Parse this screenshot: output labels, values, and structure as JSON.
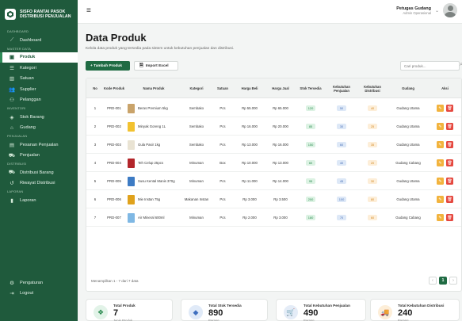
{
  "brand": {
    "line1": "SISFO RANTAI PASOK",
    "line2": "DISTRIBUSI PENJUALAN"
  },
  "sidebar": {
    "sections": [
      {
        "title": "DASHBOARD",
        "items": [
          {
            "label": "Dashboard",
            "icon": "chart-line-icon"
          }
        ]
      },
      {
        "title": "MASTER DATA",
        "items": [
          {
            "label": "Produk",
            "icon": "box-icon",
            "active": true
          },
          {
            "label": "Kategori",
            "icon": "list-icon"
          },
          {
            "label": "Satuan",
            "icon": "scale-icon"
          },
          {
            "label": "Supplier",
            "icon": "users-icon"
          },
          {
            "label": "Pelanggan",
            "icon": "user-group-icon"
          }
        ]
      },
      {
        "title": "INVENTORI",
        "items": [
          {
            "label": "Stok Barang",
            "icon": "cube-icon"
          },
          {
            "label": "Gudang",
            "icon": "warehouse-icon"
          }
        ]
      },
      {
        "title": "PENJUALAN",
        "items": [
          {
            "label": "Pesanan Penjualan",
            "icon": "calendar-icon"
          },
          {
            "label": "Penjualan",
            "icon": "cart-icon"
          }
        ]
      },
      {
        "title": "DISTRIBUSI",
        "items": [
          {
            "label": "Distribusi Barang",
            "icon": "truck-icon"
          },
          {
            "label": "Riwayat Distribusi",
            "icon": "history-icon"
          }
        ]
      },
      {
        "title": "LAPORAN",
        "items": [
          {
            "label": "Laporan",
            "icon": "bar-chart-icon"
          }
        ]
      }
    ],
    "footer": [
      {
        "label": "Pengaturan",
        "icon": "gear-icon"
      },
      {
        "label": "Logout",
        "icon": "logout-icon"
      }
    ]
  },
  "topbar": {
    "user_name": "Petugas Gudang",
    "user_role": "Admin Operasional"
  },
  "main": {
    "title": "Data Produk",
    "subtitle": "Kelola data produk yang tersedia pada sistem untuk kebutuhan penjualan dan distribusi.",
    "add_button": "+ Tambah Produk",
    "import_button": "Import Excel",
    "search_placeholder": "Cari produk..."
  },
  "table": {
    "headers": [
      "No",
      "Kode Produk",
      "Nama Produk",
      "Kategori",
      "Satuan",
      "Harga Beli",
      "Harga Jual",
      "Stok Tersedia",
      "Kebutuhan Penjualan",
      "Kebutuhan Distribusi",
      "Gudang",
      "Aksi"
    ],
    "rows": [
      {
        "no": "1",
        "kode": "PRD-001",
        "nama": "Beras Premium 5kg",
        "kategori": "Sembako",
        "satuan": "Pcs",
        "beli": "Rp 55.000",
        "jual": "Rp 65.000",
        "stok": "120",
        "kpenj": "50",
        "kdist": "40",
        "gudang": "Gudang Utama",
        "thumb": "#c9a36a"
      },
      {
        "no": "2",
        "kode": "PRD-002",
        "nama": "Minyak Goreng 1L",
        "kategori": "Sembako",
        "satuan": "Pcs",
        "beli": "Rp 16.000",
        "jual": "Rp 20.000",
        "stok": "85",
        "kpenj": "30",
        "kdist": "25",
        "gudang": "Gudang Utama",
        "thumb": "#f2c230"
      },
      {
        "no": "3",
        "kode": "PRD-003",
        "nama": "Gula Pasir 1kg",
        "kategori": "Sembako",
        "satuan": "Pcs",
        "beli": "Rp 13.000",
        "jual": "Rp 16.000",
        "stok": "150",
        "kpenj": "60",
        "kdist": "35",
        "gudang": "Gudang Utama",
        "thumb": "#e9e3d3"
      },
      {
        "no": "4",
        "kode": "PRD-004",
        "nama": "Teh Celup 25pcs",
        "kategori": "Minuman",
        "satuan": "Box",
        "beli": "Rp 10.000",
        "jual": "Rp 13.000",
        "stok": "60",
        "kpenj": "40",
        "kdist": "20",
        "gudang": "Gudang Cabang",
        "thumb": "#b3262b"
      },
      {
        "no": "5",
        "kode": "PRD-005",
        "nama": "Susu Kental Manis 370g",
        "kategori": "Minuman",
        "satuan": "Pcs",
        "beli": "Rp 11.000",
        "jual": "Rp 14.000",
        "stok": "95",
        "kpenj": "45",
        "kdist": "30",
        "gudang": "Gudang Utama",
        "thumb": "#3d7bc4"
      },
      {
        "no": "6",
        "kode": "PRD-006",
        "nama": "Mie Instan 75g",
        "kategori": "Makanan Instan",
        "satuan": "Pcs",
        "beli": "Rp 3.000",
        "jual": "Rp 3.500",
        "stok": "200",
        "kpenj": "100",
        "kdist": "80",
        "gudang": "Gudang Utama",
        "thumb": "#e0a21c"
      },
      {
        "no": "7",
        "kode": "PRD-007",
        "nama": "Air Mineral 600ml",
        "kategori": "Minuman",
        "satuan": "Pcs",
        "beli": "Rp 2.000",
        "jual": "Rp 3.000",
        "stok": "180",
        "kpenj": "70",
        "kdist": "60",
        "gudang": "Gudang Cabang",
        "thumb": "#7fb8e4"
      }
    ],
    "showing": "Menampilkan 1 - 7 dari 7 data",
    "page": "1",
    "prev": "‹",
    "next": "›"
  },
  "summary": [
    {
      "title": "Total Produk",
      "value": "7",
      "unit": "Jenis Produk",
      "icon": "box-icon",
      "bg": "#e2f3e8",
      "color": "#2a8a4f"
    },
    {
      "title": "Total Stok Tersedia",
      "value": "890",
      "unit": "Barang",
      "icon": "cube-icon",
      "bg": "#e0eaf8",
      "color": "#3f6fbf"
    },
    {
      "title": "Total Kebutuhan Penjualan",
      "value": "490",
      "unit": "Barang",
      "icon": "cart-icon",
      "bg": "#e4ecf7",
      "color": "#2b5aa3"
    },
    {
      "title": "Total Kebutuhan Distribusi",
      "value": "240",
      "unit": "Barang",
      "icon": "truck-icon",
      "bg": "#fdeed8",
      "color": "#e48a1a"
    }
  ],
  "colors": {
    "sidebar": "#1f5a3c",
    "accent": "#1f6b43",
    "edit": "#f2b33d",
    "delete": "#e5483f"
  }
}
